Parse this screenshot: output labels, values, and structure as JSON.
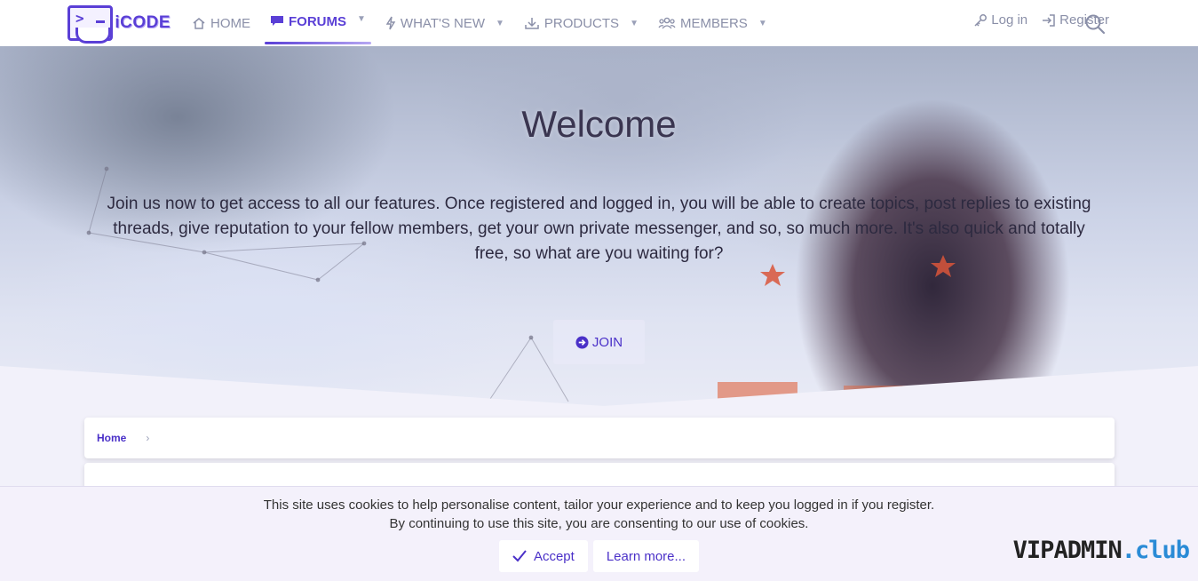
{
  "brand": {
    "logo_text": "iCODE"
  },
  "nav": {
    "items": [
      {
        "label": "HOME",
        "icon": "home-icon",
        "active": false
      },
      {
        "label": "FORUMS",
        "icon": "comment-icon",
        "active": true
      },
      {
        "label": "WHAT'S NEW",
        "icon": "bolt-icon",
        "active": false
      },
      {
        "label": "PRODUCTS",
        "icon": "download-icon",
        "active": false
      },
      {
        "label": "MEMBERS",
        "icon": "users-icon",
        "active": false
      }
    ],
    "login_label": "Log in",
    "register_label": "Register"
  },
  "hero": {
    "title": "Welcome",
    "text": "Join us now to get access to all our features. Once registered and logged in, you will be able to create topics, post replies to existing threads, give reputation to your fellow members, get your own private messenger, and so, so much more. It's also quick and totally free, so what are you waiting for?",
    "join_label": "JOIN"
  },
  "breadcrumb": {
    "home": "Home"
  },
  "cookie": {
    "line1": "This site uses cookies to help personalise content, tailor your experience and to keep you logged in if you register.",
    "line2": "By continuing to use this site, you are consenting to our use of cookies.",
    "accept_label": "Accept",
    "learn_label": "Learn more..."
  },
  "watermark": {
    "main": "VIPADMIN",
    "suffix": ".club"
  },
  "colors": {
    "accent": "#5a3fd6",
    "link": "#4a30c8",
    "muted": "#8a8fa8"
  }
}
